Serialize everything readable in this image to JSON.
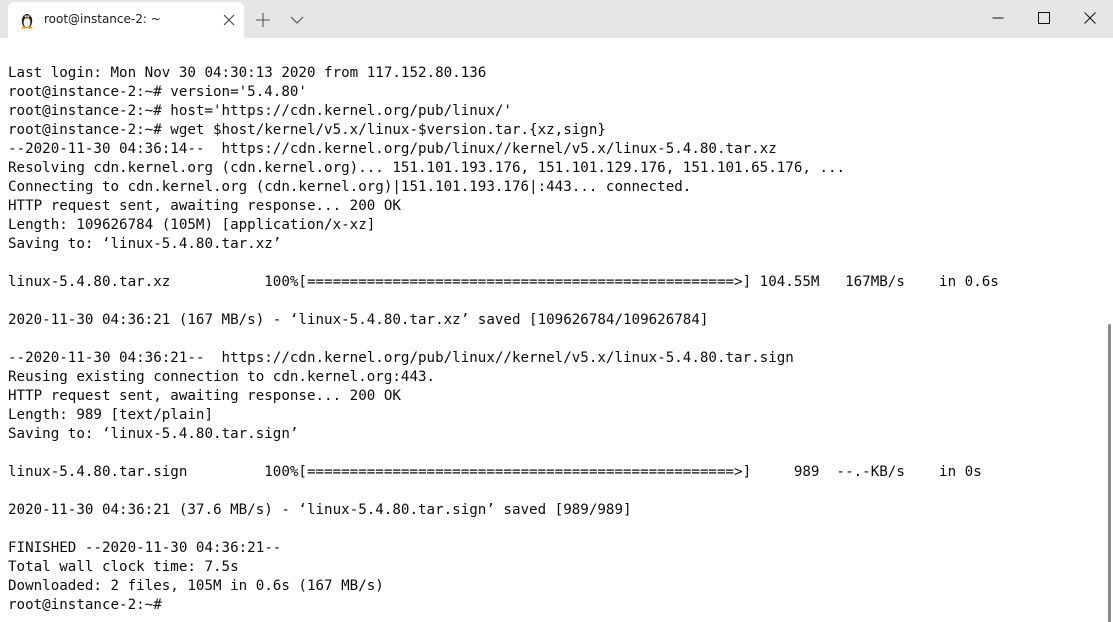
{
  "tab": {
    "icon": "tux-penguin-icon",
    "title": "root@instance-2: ~"
  },
  "titlebar_controls": {
    "new_tab_icon": "plus-icon",
    "dropdown_icon": "chevron-down-icon",
    "minimize_icon": "minimize-icon",
    "maximize_icon": "maximize-icon",
    "close_icon": "close-icon"
  },
  "terminal": {
    "lines": [
      "Last login: Mon Nov 30 04:30:13 2020 from 117.152.80.136",
      "root@instance-2:~# version='5.4.80'",
      "root@instance-2:~# host='https://cdn.kernel.org/pub/linux/'",
      "root@instance-2:~# wget $host/kernel/v5.x/linux-$version.tar.{xz,sign}",
      "--2020-11-30 04:36:14--  https://cdn.kernel.org/pub/linux//kernel/v5.x/linux-5.4.80.tar.xz",
      "Resolving cdn.kernel.org (cdn.kernel.org)... 151.101.193.176, 151.101.129.176, 151.101.65.176, ...",
      "Connecting to cdn.kernel.org (cdn.kernel.org)|151.101.193.176|:443... connected.",
      "HTTP request sent, awaiting response... 200 OK",
      "Length: 109626784 (105M) [application/x-xz]",
      "Saving to: ‘linux-5.4.80.tar.xz’",
      "",
      "linux-5.4.80.tar.xz           100%[==================================================>] 104.55M   167MB/s    in 0.6s",
      "",
      "2020-11-30 04:36:21 (167 MB/s) - ‘linux-5.4.80.tar.xz’ saved [109626784/109626784]",
      "",
      "--2020-11-30 04:36:21--  https://cdn.kernel.org/pub/linux//kernel/v5.x/linux-5.4.80.tar.sign",
      "Reusing existing connection to cdn.kernel.org:443.",
      "HTTP request sent, awaiting response... 200 OK",
      "Length: 989 [text/plain]",
      "Saving to: ‘linux-5.4.80.tar.sign’",
      "",
      "linux-5.4.80.tar.sign         100%[==================================================>]     989  --.-KB/s    in 0s",
      "",
      "2020-11-30 04:36:21 (37.6 MB/s) - ‘linux-5.4.80.tar.sign’ saved [989/989]",
      "",
      "FINISHED --2020-11-30 04:36:21--",
      "Total wall clock time: 7.5s",
      "Downloaded: 2 files, 105M in 0.6s (167 MB/s)",
      "root@instance-2:~# "
    ]
  }
}
